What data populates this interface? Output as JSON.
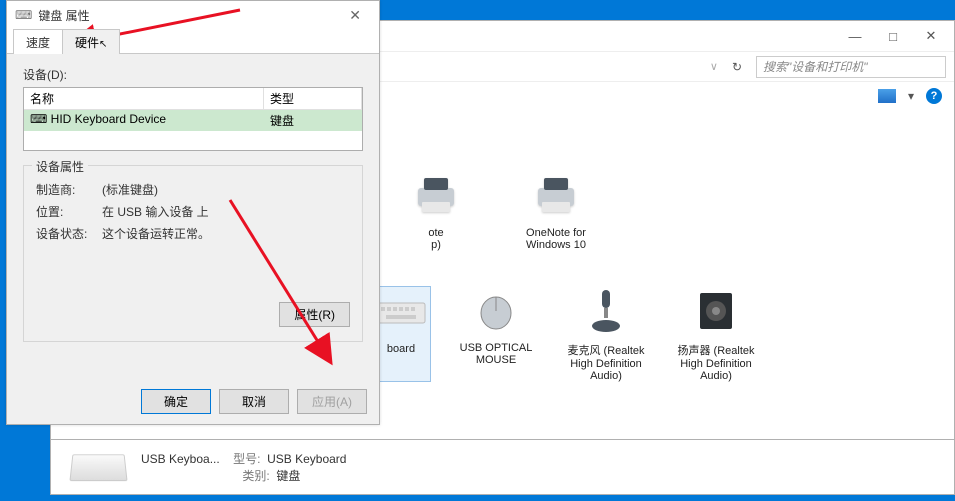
{
  "explorer": {
    "search_placeholder": "搜索\"设备和打印机\"",
    "win_min": "—",
    "win_max": "□",
    "win_close": "✕",
    "addr_chevron": "∨",
    "refresh": "↻",
    "help": "?",
    "devices_row1": [
      {
        "label1": "ote",
        "label2": "p)"
      },
      {
        "label1": "OneNote for",
        "label2": "Windows 10"
      }
    ],
    "devices_row2": [
      {
        "label1": "board",
        "label2": ""
      },
      {
        "label1": "USB OPTICAL",
        "label2": "MOUSE"
      },
      {
        "label1": "麦克风 (Realtek",
        "label2": "High Definition",
        "label3": "Audio)"
      },
      {
        "label1": "扬声器 (Realtek",
        "label2": "High Definition",
        "label3": "Audio)"
      }
    ]
  },
  "bottom": {
    "name": "USB Keyboa...",
    "model_k": "型号:",
    "model_v": "USB Keyboard",
    "cat_k": "类别:",
    "cat_v": "键盘"
  },
  "dialog": {
    "title": "键盘 属性",
    "close": "✕",
    "tabs": {
      "speed": "速度",
      "hardware": "硬件"
    },
    "cursor": "↖",
    "devices_label": "设备(D):",
    "list": {
      "col_name": "名称",
      "col_type": "类型",
      "row_name": "HID Keyboard Device",
      "row_type": "键盘",
      "row_icon": "⌨"
    },
    "group_title": "设备属性",
    "props": {
      "mfr_k": "制造商:",
      "mfr_v": "(标准键盘)",
      "loc_k": "位置:",
      "loc_v": "在 USB 输入设备 上",
      "stat_k": "设备状态:",
      "stat_v": "这个设备运转正常。"
    },
    "btn_properties": "属性(R)",
    "btn_ok": "确定",
    "btn_cancel": "取消",
    "btn_apply": "应用(A)"
  }
}
